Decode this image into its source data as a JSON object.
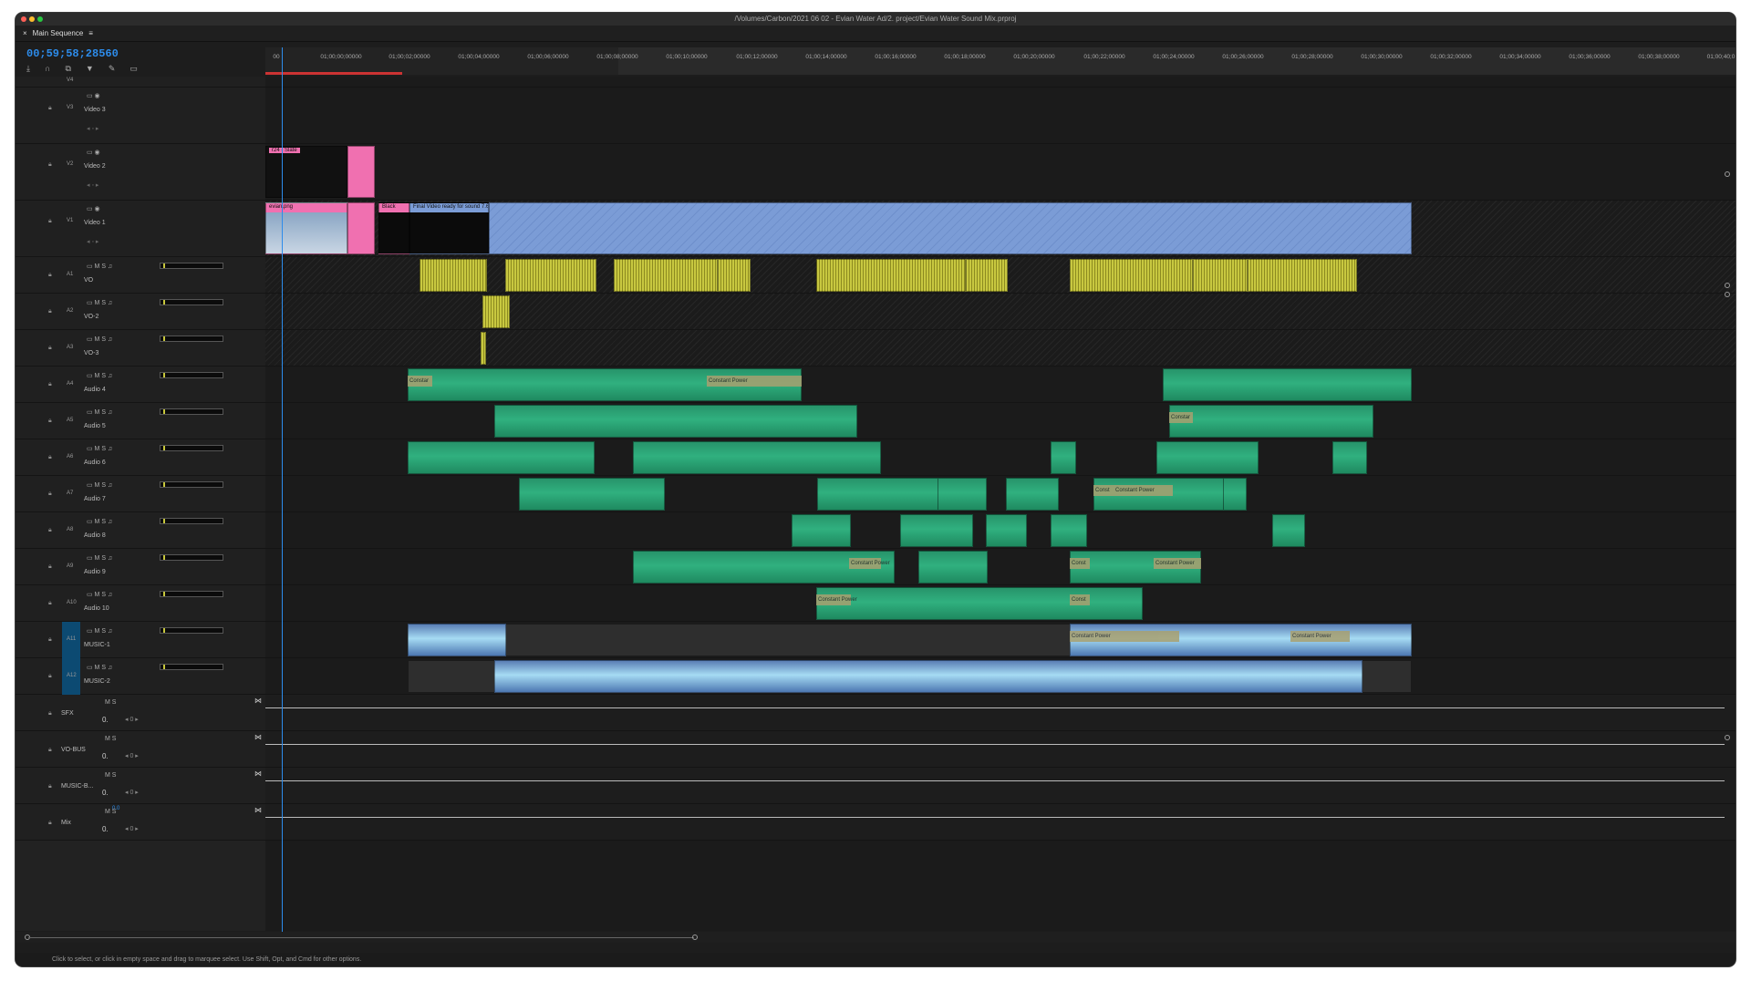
{
  "window": {
    "title": "/Volumes/Carbon/2021 06 02 - Evian Water Ad/2. project/Evian Water Sound Mix.prproj"
  },
  "panel": {
    "tab": "Main Sequence",
    "close": "×",
    "menu": "≡"
  },
  "timecode": "00;59;58;28560",
  "ruler_ticks": [
    "00",
    "01;00;00;00000",
    "01;00;02;00000",
    "01;00;04;00000",
    "01;00;06;00000",
    "01;00;08;00000",
    "01;00;10;00000",
    "01;00;12;00000",
    "01;00;14;00000",
    "01;00;16;00000",
    "01;00;18;00000",
    "01;00;20;00000",
    "01;00;22;00000",
    "01;00;24;00000",
    "01;00;26;00000",
    "01;00;28;00000",
    "01;00;30;00000",
    "01;00;32;00000",
    "01;00;34;00000",
    "01;00;36;00000",
    "01;00;38;00000",
    "01;00;40;0"
  ],
  "video_tracks": [
    {
      "id": "V4",
      "name": ""
    },
    {
      "id": "V3",
      "name": "Video 3"
    },
    {
      "id": "V2",
      "name": "Video 2"
    },
    {
      "id": "V1",
      "name": "Video 1"
    }
  ],
  "audio_tracks": [
    {
      "id": "A1",
      "name": "VO"
    },
    {
      "id": "A2",
      "name": "VO-2"
    },
    {
      "id": "A3",
      "name": "VO-3"
    },
    {
      "id": "A4",
      "name": "Audio 4"
    },
    {
      "id": "A5",
      "name": "Audio 5"
    },
    {
      "id": "A6",
      "name": "Audio 6"
    },
    {
      "id": "A7",
      "name": "Audio 7"
    },
    {
      "id": "A8",
      "name": "Audio 8"
    },
    {
      "id": "A9",
      "name": "Audio 9"
    },
    {
      "id": "A10",
      "name": "Audio 10"
    },
    {
      "id": "A11",
      "name": "MUSIC-1"
    },
    {
      "id": "A12",
      "name": "MUSIC-2"
    }
  ],
  "bus_tracks": [
    {
      "name": "SFX",
      "value": "0."
    },
    {
      "name": "VO-BUS",
      "value": "0."
    },
    {
      "name": "MUSIC-B...",
      "value": "0."
    },
    {
      "name": "Mix",
      "value": "0.",
      "top_value": "0.0"
    }
  ],
  "track_buttons": {
    "mute": "M",
    "solo": "S",
    "zero": "0"
  },
  "clips": {
    "slate": "r24 - Slate",
    "evian": "evian.png",
    "black": "Black",
    "final": "Final Video ready for sound 7.6.mov",
    "constant_power": "Constant Power",
    "constant_short": "Constar",
    "const_short": "Const"
  },
  "status": "Click to select, or click in empty space and drag to marquee select. Use Shift, Opt, and Cmd for other options.",
  "colors": {
    "accent": "#2d8ceb",
    "audio_clip": "#2aa876",
    "music_clip": "#a6dbf3",
    "vo_clip": "#c8c840",
    "slate_clip": "#f070b0",
    "video_clip": "#7b9cd6"
  }
}
